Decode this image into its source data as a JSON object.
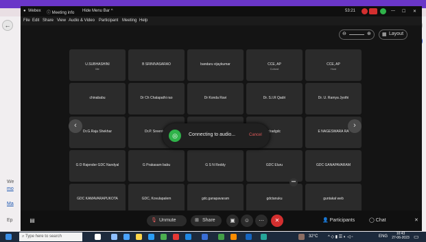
{
  "browser": {
    "side_labels": [
      "We",
      "mo",
      "Ma",
      "Ep"
    ]
  },
  "titlebar": {
    "app": "Webex",
    "meeting_info": "Meeting info",
    "hide_menu": "Hide Menu Bar",
    "time": "53:21"
  },
  "menu": [
    "File",
    "Edit",
    "Share",
    "View",
    "Audio & Video",
    "Participant",
    "Meeting",
    "Help"
  ],
  "layout_label": "Layout",
  "participants": [
    {
      "name": "U.SUBHASHINI",
      "sub": "Me"
    },
    {
      "name": "B SRINIVASARAO",
      "sub": ""
    },
    {
      "name": "bandaru vijaykumar",
      "sub": ""
    },
    {
      "name": "CCE, AP",
      "sub": "Cohost"
    },
    {
      "name": "CCE, AP",
      "sub": "Host"
    },
    {
      "name": "chinababu",
      "sub": ""
    },
    {
      "name": "Dr Ch Chalapathi rao",
      "sub": ""
    },
    {
      "name": "Dr Konda Ravi",
      "sub": ""
    },
    {
      "name": "Dr. S.I.R Qadri",
      "sub": ""
    },
    {
      "name": "Dr. U. Ramya Jyothi",
      "sub": ""
    },
    {
      "name": "Dr.G.Raja Shekhar",
      "sub": ""
    },
    {
      "name": "Dr.P. Sreenivas",
      "sub": ""
    },
    {
      "name": "",
      "sub": ""
    },
    {
      "name": "dradgdc",
      "sub": ""
    },
    {
      "name": "E NAGESWARA RA",
      "sub": ""
    },
    {
      "name": "G D Rajender GDC Nandyal",
      "sub": ""
    },
    {
      "name": "G Prakasam babu",
      "sub": ""
    },
    {
      "name": "G S N Reddy",
      "sub": ""
    },
    {
      "name": "GDC Eluru",
      "sub": ""
    },
    {
      "name": "GDC GANAPAVARAM",
      "sub": ""
    },
    {
      "name": "GDC KAMAVARAPUKOTA",
      "sub": ""
    },
    {
      "name": "GDC, Kovulapalem",
      "sub": ""
    },
    {
      "name": "gdc.ganapavaram",
      "sub": ""
    },
    {
      "name": "gdctanuku",
      "sub": ""
    },
    {
      "name": "guntakal web",
      "sub": ""
    }
  ],
  "toast": {
    "message": "Connecting to audio...",
    "cancel": "Cancel"
  },
  "controls": {
    "unmute": "Unmute",
    "share": "Share",
    "participants": "Participants",
    "chat": "Chat"
  },
  "taskbar": {
    "search": "Type here to search",
    "temp": "32°C",
    "lang": "ENG",
    "time": "10:43",
    "date": "27-06-2023"
  }
}
